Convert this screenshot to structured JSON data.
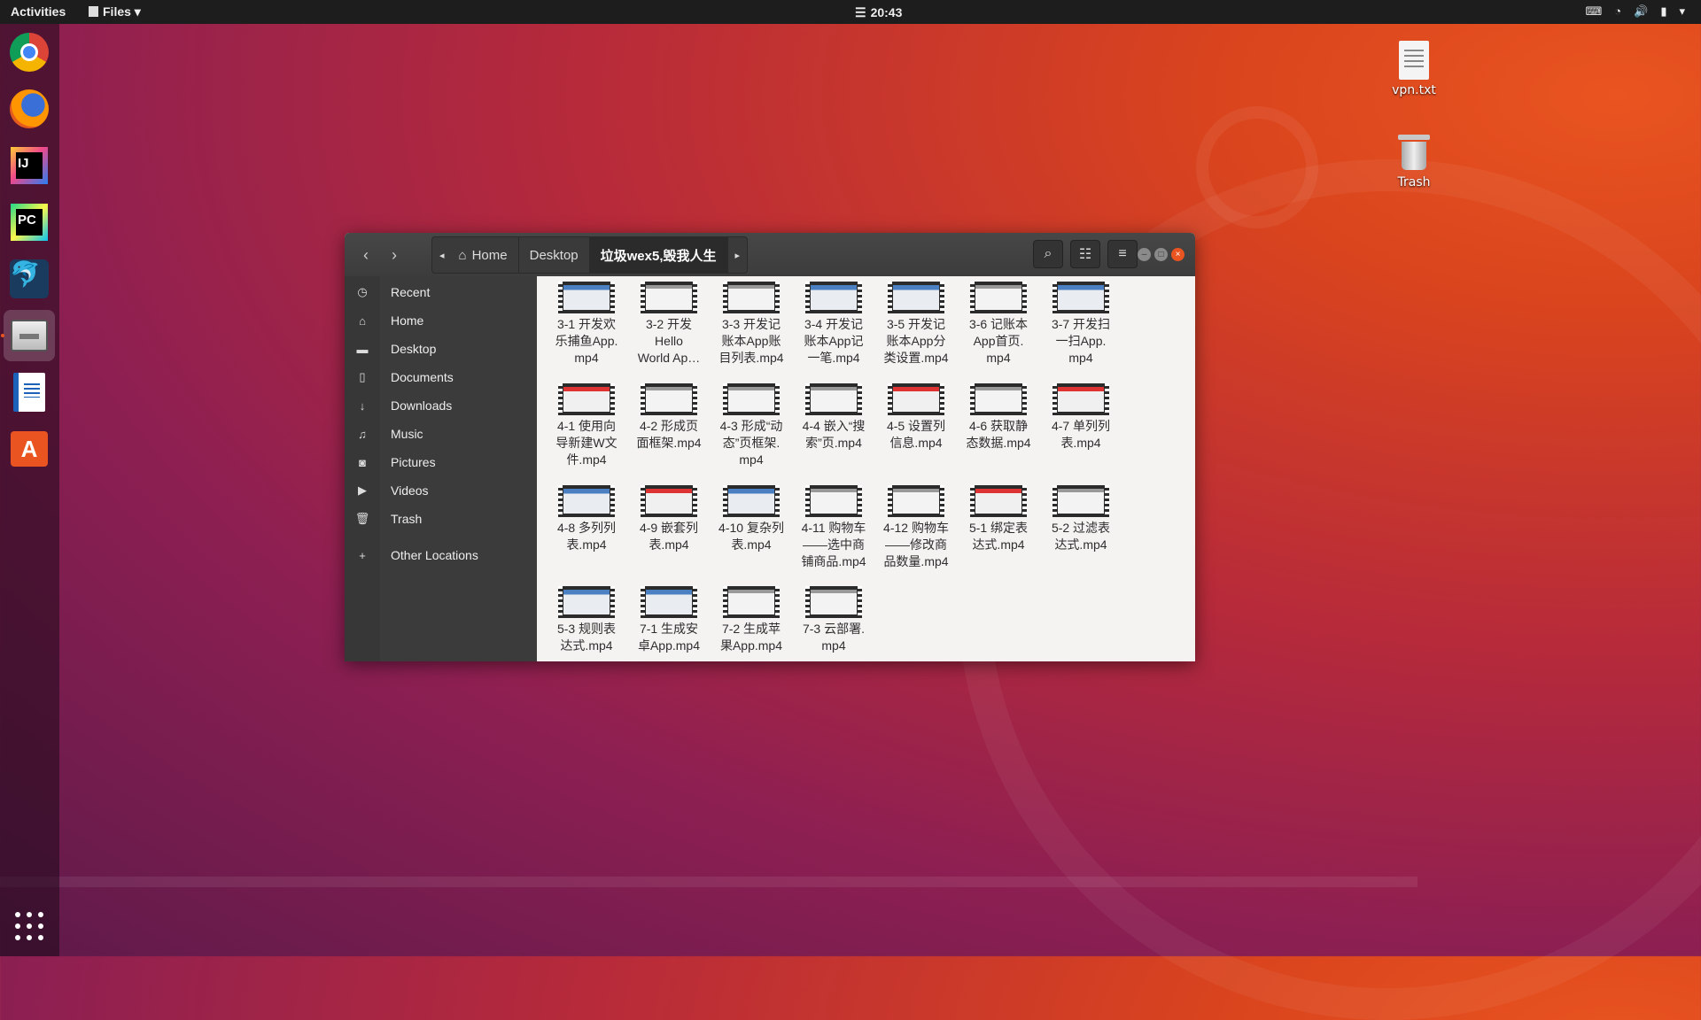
{
  "topbar": {
    "activities": "Activities",
    "app_menu": "Files",
    "clock": "20:43"
  },
  "dock": {
    "apps": [
      "Google Chrome",
      "Firefox",
      "IntelliJ IDEA",
      "PyCharm",
      "MySQL Workbench",
      "Files",
      "LibreOffice Writer",
      "Ubuntu Software"
    ]
  },
  "desktop": {
    "icons": [
      {
        "label": "vpn.txt",
        "icon": "text-file-icon"
      },
      {
        "label": "Trash",
        "icon": "trash-icon"
      }
    ]
  },
  "window": {
    "breadcrumbs": [
      "Home",
      "Desktop",
      "垃圾wex5,毁我人生"
    ],
    "sidebar": [
      {
        "label": "Recent",
        "icon": "clock-icon"
      },
      {
        "label": "Home",
        "icon": "home-icon"
      },
      {
        "label": "Desktop",
        "icon": "folder-icon"
      },
      {
        "label": "Documents",
        "icon": "document-icon"
      },
      {
        "label": "Downloads",
        "icon": "download-icon"
      },
      {
        "label": "Music",
        "icon": "music-icon"
      },
      {
        "label": "Pictures",
        "icon": "camera-icon"
      },
      {
        "label": "Videos",
        "icon": "video-icon"
      },
      {
        "label": "Trash",
        "icon": "trash-icon"
      },
      {
        "label": "Other Locations",
        "icon": "plus-icon"
      }
    ],
    "files": [
      [
        "3-1 开发欢",
        "乐捕鱼App.",
        "mp4"
      ],
      [
        "3-2 开发",
        "Hello",
        "World Ap…"
      ],
      [
        "3-3 开发记",
        "账本App账",
        "目列表.mp4"
      ],
      [
        "3-4 开发记",
        "账本App记",
        "一笔.mp4"
      ],
      [
        "3-5 开发记",
        "账本App分",
        "类设置.mp4"
      ],
      [
        "3-6 记账本",
        "App首页.",
        "mp4"
      ],
      [
        "3-7 开发扫",
        "一扫App.",
        "mp4"
      ],
      [
        "4-1 使用向",
        "导新建W文",
        "件.mp4"
      ],
      [
        "4-2 形成页",
        "面框架.mp4"
      ],
      [
        "4-3 形成“动",
        "态”页框架.",
        "mp4"
      ],
      [
        "4-4 嵌入“搜",
        "索”页.mp4"
      ],
      [
        "4-5 设置列",
        "信息.mp4"
      ],
      [
        "4-6 获取静",
        "态数据.mp4"
      ],
      [
        "4-7 单列列",
        "表.mp4"
      ],
      [
        "4-8 多列列",
        "表.mp4"
      ],
      [
        "4-9 嵌套列",
        "表.mp4"
      ],
      [
        "4-10 复杂列",
        "表.mp4"
      ],
      [
        "4-11 购物车",
        "——选中商",
        "铺商品.mp4"
      ],
      [
        "4-12 购物车",
        "——修改商",
        "品数量.mp4"
      ],
      [
        "5-1 绑定表",
        "达式.mp4"
      ],
      [
        "5-2 过滤表",
        "达式.mp4"
      ],
      [
        "5-3 规则表",
        "达式.mp4"
      ],
      [
        "7-1 生成安",
        "卓App.mp4"
      ],
      [
        "7-2 生成苹",
        "果App.mp4"
      ],
      [
        "7-3 云部署.",
        "mp4"
      ]
    ]
  }
}
